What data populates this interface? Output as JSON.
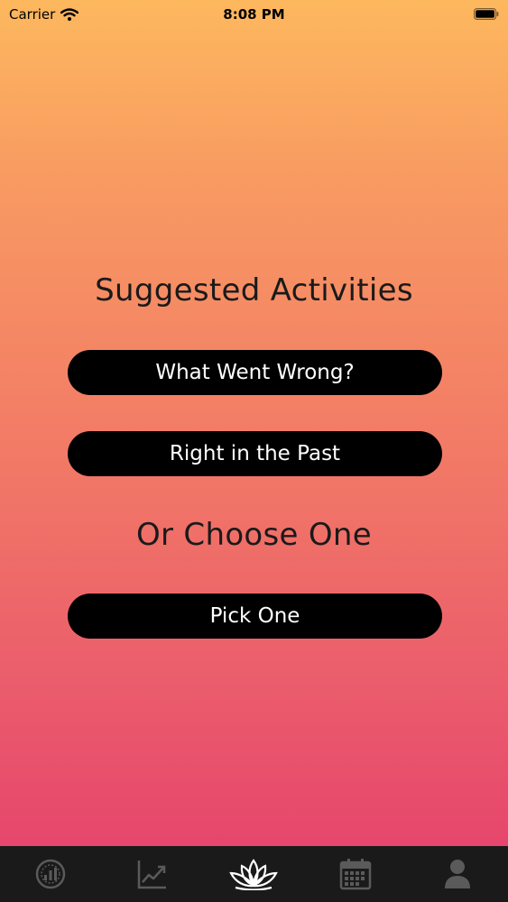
{
  "status_bar": {
    "carrier": "Carrier",
    "time": "8:08 PM"
  },
  "main": {
    "title": "Suggested Activities",
    "suggested_buttons": [
      {
        "label": "What Went Wrong?"
      },
      {
        "label": "Right in the Past"
      }
    ],
    "choose_heading": "Or Choose One",
    "pick_button_label": "Pick One"
  },
  "tab_bar": {
    "tabs": [
      {
        "icon": "gauge-icon",
        "active": false
      },
      {
        "icon": "trend-chart-icon",
        "active": false
      },
      {
        "icon": "lotus-icon",
        "active": true
      },
      {
        "icon": "calendar-icon",
        "active": false
      },
      {
        "icon": "profile-icon",
        "active": false
      }
    ],
    "inactive_color": "#5a5a5a",
    "active_color": "#ffffff"
  },
  "colors": {
    "gradient_top": "#fdb85e",
    "gradient_bottom": "#e53e6d",
    "button_bg": "#000000"
  }
}
